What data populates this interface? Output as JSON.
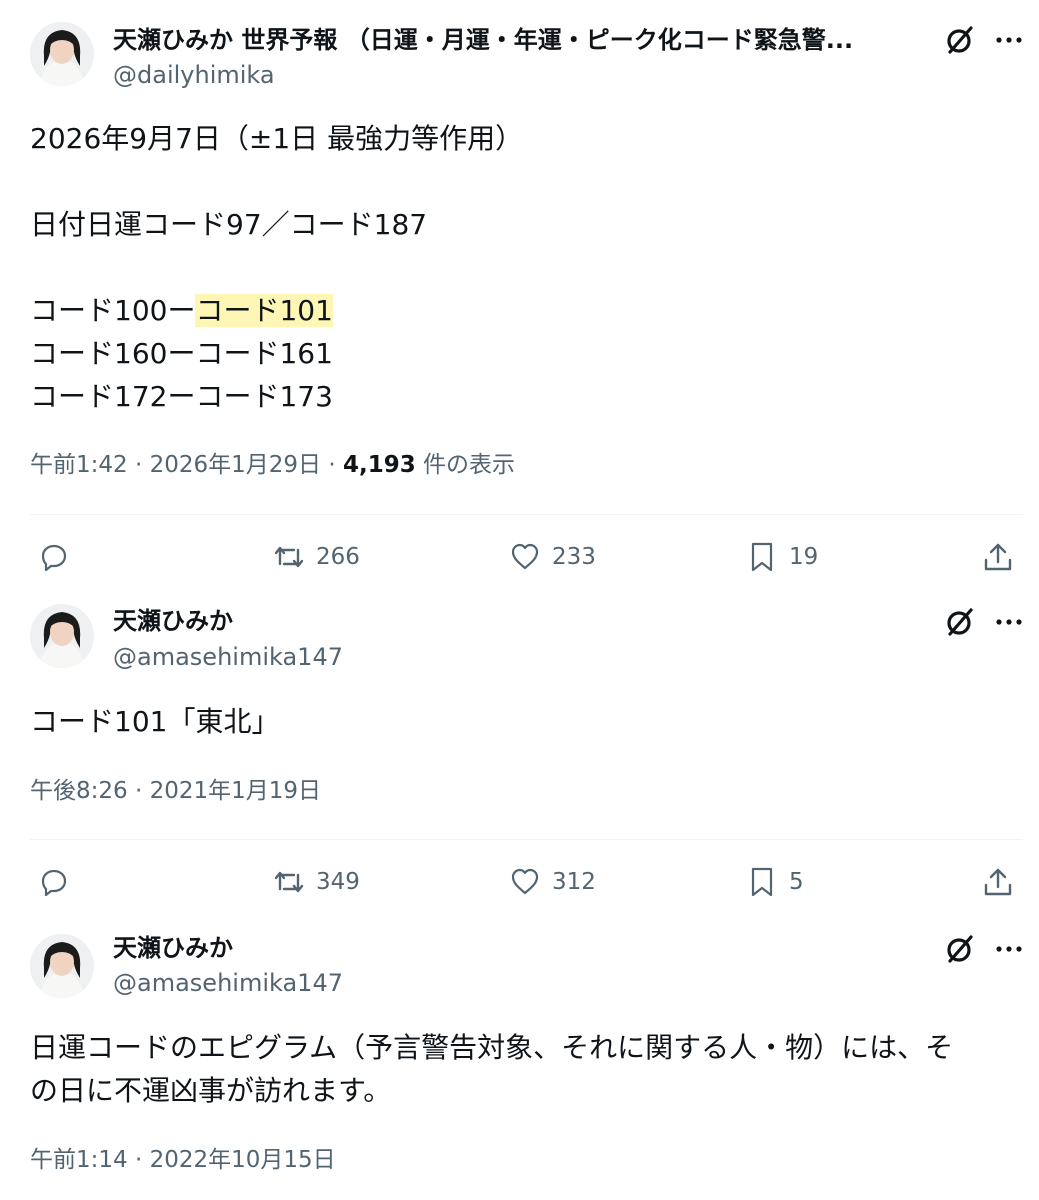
{
  "tweets": [
    {
      "display_name": "天瀬ひみか 世界予報 （日運・月運・年運・ピーク化コード緊急警...",
      "handle": "@dailyhimika",
      "lines": [
        "2026年9月7日（±1日 最強力等作用）",
        "",
        "日付日運コード97／コード187",
        "",
        "コード100ー",
        "コード160ーコード161",
        "コード172ーコード173"
      ],
      "highlighted": "コード101",
      "time": "午前1:42",
      "date": "2026年1月29日",
      "views": "4,193",
      "views_label": "件の表示",
      "actions": {
        "reposts": "266",
        "likes": "233",
        "bookmarks": "19"
      }
    },
    {
      "display_name": "天瀬ひみか",
      "handle": "@amasehimika147",
      "lines": [
        "コード101「東北」"
      ],
      "time": "午後8:26",
      "date": "2021年1月19日",
      "actions": {
        "reposts": "349",
        "likes": "312",
        "bookmarks": "5"
      }
    },
    {
      "display_name": "天瀬ひみか",
      "handle": "@amasehimika147",
      "lines": [
        "日運コードのエピグラム（予言警告対象、それに関する人・物）には、そ",
        "の日に不運凶事が訪れます。"
      ],
      "time": "午前1:14",
      "date": "2022年10月15日"
    }
  ],
  "separator": " · ",
  "icons": {
    "grok": "grok-icon",
    "more": "more-icon",
    "reply": "reply-icon",
    "repost": "repost-icon",
    "like": "heart-icon",
    "bookmark": "bookmark-icon",
    "share": "share-icon"
  },
  "colors": {
    "text": "#0f1419",
    "secondary": "#536471",
    "highlight": "#fdf6b4",
    "divider": "#eff3f4"
  }
}
